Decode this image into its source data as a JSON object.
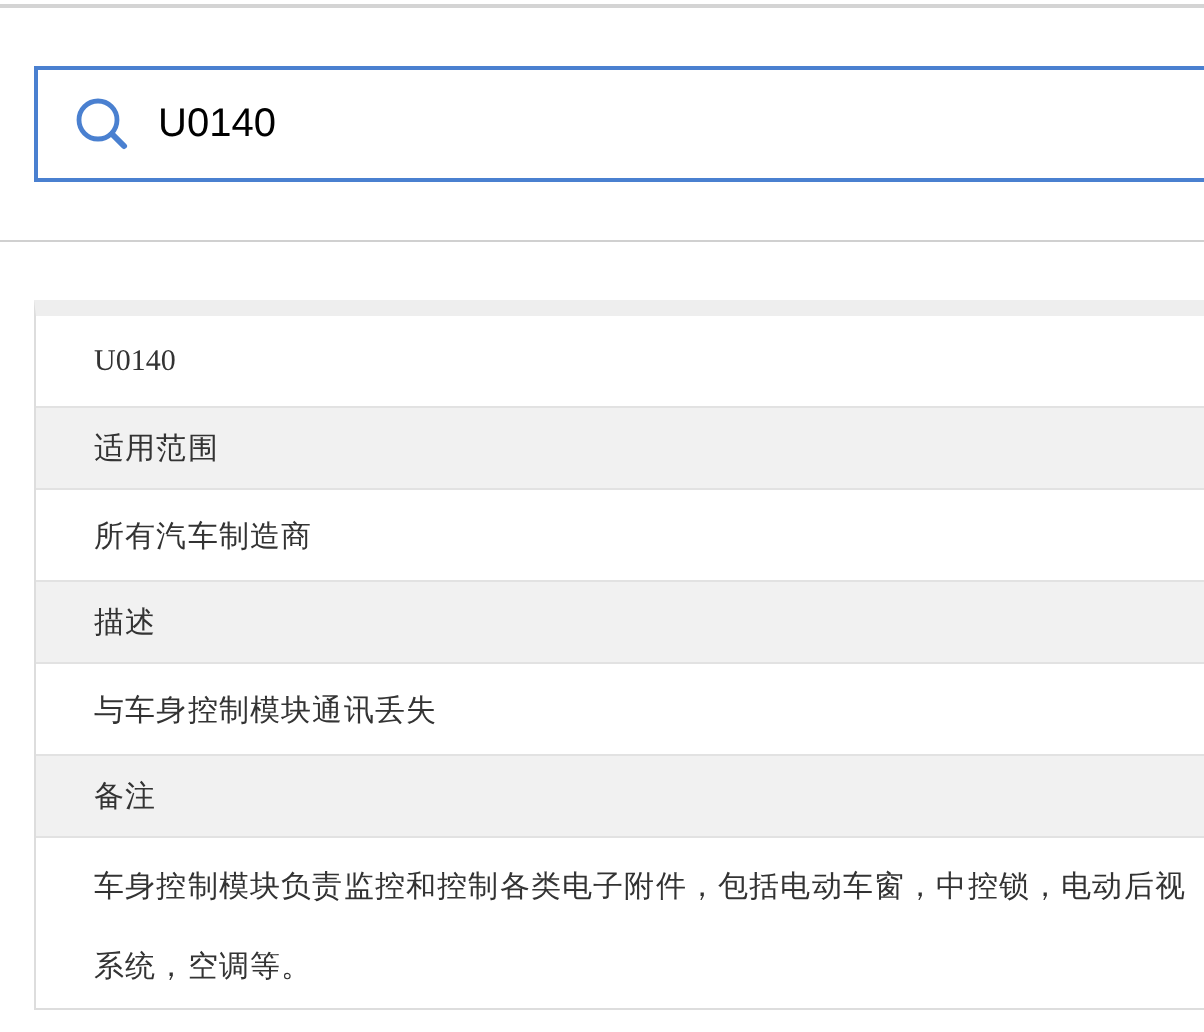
{
  "search": {
    "value": "U0140"
  },
  "details": [
    {
      "kind": "value",
      "lines": [
        "U0140"
      ],
      "serif": true
    },
    {
      "kind": "label",
      "lines": [
        "适用范围"
      ]
    },
    {
      "kind": "value",
      "lines": [
        "所有汽车制造商"
      ]
    },
    {
      "kind": "label",
      "lines": [
        "描述"
      ]
    },
    {
      "kind": "value",
      "lines": [
        "与车身控制模块通讯丢失"
      ]
    },
    {
      "kind": "label",
      "lines": [
        "备注"
      ]
    },
    {
      "kind": "value",
      "lines": [
        "车身控制模块负责监控和控制各类电子附件，包括电动车窗，中控锁，电动后视",
        "系统，空调等。"
      ]
    }
  ]
}
